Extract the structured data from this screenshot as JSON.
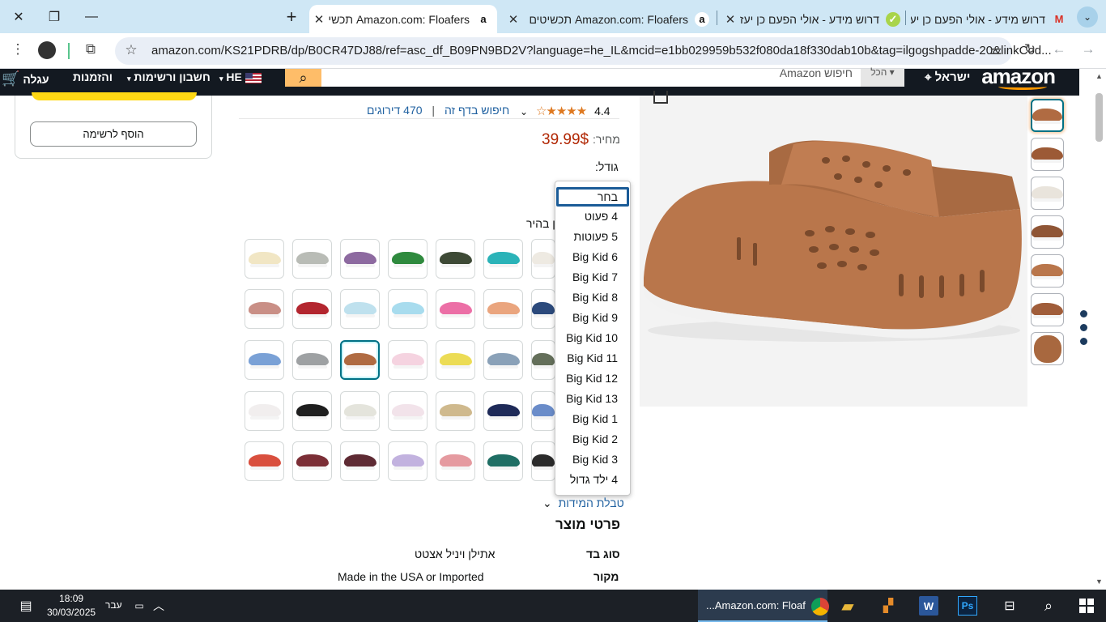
{
  "browser": {
    "tabs": [
      {
        "title": "Amazon.com: Floafers תכשיטים",
        "active": true,
        "favicon": "a"
      },
      {
        "title": "Amazon.com: Floafers תכשיטים",
        "active": false,
        "favicon": "a"
      },
      {
        "title": "דרוש מידע - אולי הפעם כן יעזרו",
        "active": false,
        "favicon": "✓"
      },
      {
        "title": "דרוש מידע - אולי הפעם כן יעזרו",
        "active": false,
        "favicon": "M"
      }
    ],
    "url": "amazon.com/KS21PDRB/dp/B0CR47DJ88/ref=asc_df_B09PN9BD2V?language=he_IL&mcid=e1bb029959b532f080da18f330dab10b&tag=ilgogshpadde-20&linkCod..."
  },
  "header": {
    "logo": "amazon",
    "location": "ישראל",
    "search_category": "הכל",
    "search_placeholder": "חיפוש Amazon",
    "language": "HE",
    "account": "חשבון ורשימות",
    "orders": "והזמנות",
    "cart": "עגלה"
  },
  "buybox": {
    "add_to_list": "הוסף לרשימה"
  },
  "product": {
    "rating": "4.4",
    "reviews": "470 דירוגים",
    "search_page": "חיפוש בדף זה",
    "price_label": "מחיר:",
    "price": "39.99$",
    "size_label": "גודל:",
    "color_label": "ן בהיר",
    "size_chart": "טבלת המידות",
    "details_title": "פרטי מוצר",
    "details": [
      {
        "key": "סוג בד",
        "value": "אתילן ויניל אצטט"
      },
      {
        "key": "מקור",
        "value": "Made in the USA or Imported"
      }
    ]
  },
  "size_options": [
    "בחר",
    "4 פעוט",
    "5 פעוטות",
    "Big Kid 6",
    "Big Kid 7",
    "Big Kid 8",
    "Big Kid 9",
    "Big Kid 10",
    "Big Kid 11",
    "Big Kid 12",
    "Big Kid 13",
    "Big Kid 1",
    "Big Kid 2",
    "Big Kid 3",
    "4 ילד גדול"
  ],
  "swatch_colors": [
    [
      "#f1e6c4",
      "#b9bcb6",
      "#8d6aa0",
      "#2f8a3e",
      "#3e4a36",
      "#2bb3b8",
      "#eeeae2"
    ],
    [
      "#c98f86",
      "#b3262f",
      "#bfe1ee",
      "#a8dcee",
      "#ec6fa6",
      "#eaa57e",
      "#2c4a7c"
    ],
    [
      "#7aa1d6",
      "#9ea1a3",
      "#b06b42",
      "#f5d3e0",
      "#ecdc55",
      "#8aa1b8",
      "#646f5a"
    ],
    [
      "#f1eeee",
      "#1e1e1e",
      "#e4e4dc",
      "#f2e3ea",
      "#cfb98d",
      "#1e2a58",
      "#6a8cc9"
    ],
    [
      "#d94f3e",
      "#7b2e36",
      "#5e2a33",
      "#c2b2df",
      "#e59aa0",
      "#1f6e64",
      "#2b2b2b"
    ]
  ],
  "selected_swatch": "2-2",
  "colors": {
    "amazon_header": "#131921",
    "price": "#b12704",
    "link": "#2162a1",
    "dropdown_selected_border": "#1a5b97"
  },
  "taskbar": {
    "time": "18:09",
    "date": "30/03/2025",
    "language": "עבר",
    "active_app": "...Amazon.com: Floaf"
  }
}
